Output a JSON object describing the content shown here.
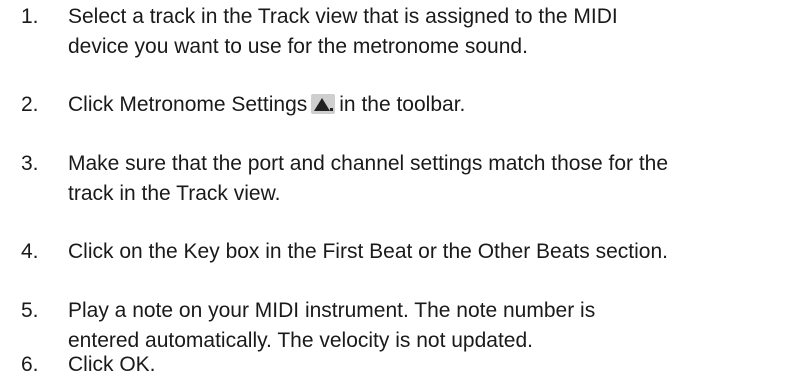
{
  "steps": [
    {
      "number": "1.",
      "lines": [
        "Select a track in the Track view that is assigned to the MIDI",
        "device you want to use for the metronome sound."
      ]
    },
    {
      "number": "2.",
      "before_icon": "Click Metronome Settings",
      "icon": "metronome-settings-icon",
      "after_icon": "in the toolbar."
    },
    {
      "number": "3.",
      "lines": [
        "Make sure that the port and channel settings match those for the",
        "track in the Track view."
      ]
    },
    {
      "number": "4.",
      "lines": [
        "Click on the Key box in the First Beat or the Other Beats section."
      ]
    },
    {
      "number": "5.",
      "lines": [
        "Play a note on your MIDI instrument. The note number is",
        "entered automatically. The velocity is not updated."
      ]
    },
    {
      "number": "6.",
      "lines": [
        "Click OK."
      ]
    }
  ]
}
